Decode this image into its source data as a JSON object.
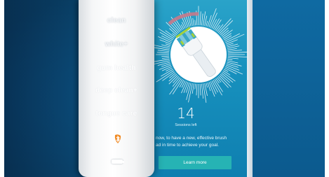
{
  "toothbrush": {
    "modes": [
      "clean",
      "white+",
      "gum health",
      "deep clean+",
      "tongue care"
    ]
  },
  "app": {
    "sessions_count": "14",
    "sessions_label": "Sessions left",
    "message_line1": "now, to have a new, effective brush",
    "message_line2": "ad in time to achieve your goal.",
    "cta_label": "Learn more"
  },
  "colors": {
    "accent": "#26b3b4",
    "background": "#0d5d93",
    "phone_screen": "#1791be",
    "progress_arc": "#c8798a"
  },
  "icons": [
    "bluetooth-app-icon",
    "battery-icon",
    "brush-head-icon"
  ]
}
